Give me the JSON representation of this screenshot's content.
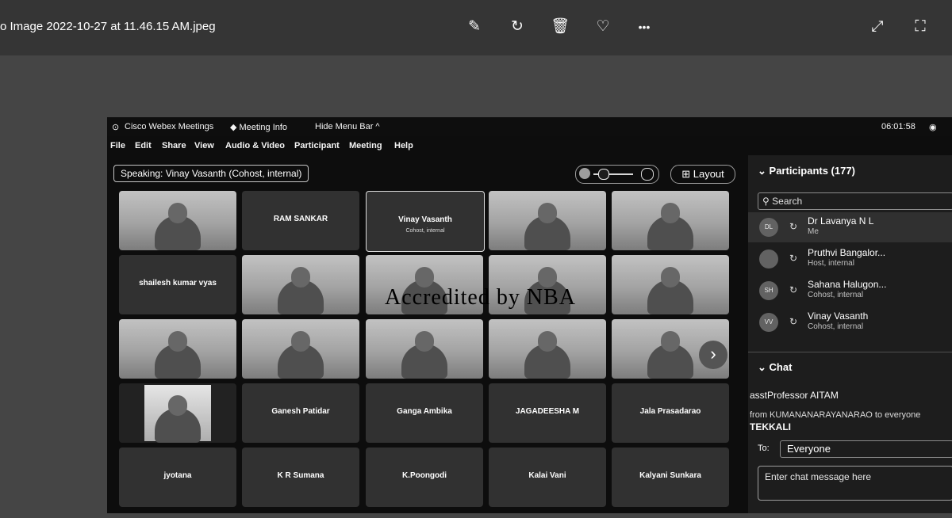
{
  "viewer": {
    "title": "o Image 2022-10-27 at 11.46.15 AM.jpeg",
    "icons": [
      "edit-icon",
      "rotate-icon",
      "delete-icon",
      "favorite-icon",
      "more-icon",
      "expand-icon",
      "fullscreen-icon"
    ],
    "icon_glyphs": [
      "✎",
      "↻",
      "🗑",
      "♡",
      "•••",
      "⤢",
      "⛶"
    ]
  },
  "webex": {
    "app_title": "Cisco Webex Meetings",
    "meeting_info": "Meeting Info",
    "hide_menu": "Hide Menu Bar ^",
    "clock": "06:01:58",
    "menu": [
      "File",
      "Edit",
      "Share",
      "View",
      "Audio & Video",
      "Participant",
      "Meeting",
      "Help"
    ],
    "speaking": "Speaking: Vinay Vasanth (Cohost, internal)",
    "layout_label": "Layout",
    "watermark": "Accredited by NBA"
  },
  "tiles": [
    {
      "name": "",
      "video": true
    },
    {
      "name": "RAM SANKAR",
      "video": false
    },
    {
      "name": "Vinay Vasanth",
      "sub": "Cohost, internal",
      "video": false,
      "active": true
    },
    {
      "name": "",
      "video": true
    },
    {
      "name": "",
      "video": true
    },
    {
      "name": "shailesh kumar vyas",
      "video": false
    },
    {
      "name": "",
      "video": true
    },
    {
      "name": "",
      "video": true
    },
    {
      "name": "",
      "video": true
    },
    {
      "name": "",
      "video": true
    },
    {
      "name": "",
      "video": true
    },
    {
      "name": "",
      "video": true
    },
    {
      "name": "",
      "video": true
    },
    {
      "name": "",
      "video": true
    },
    {
      "name": "",
      "video": true
    },
    {
      "name": "",
      "video": true,
      "small": true
    },
    {
      "name": "Ganesh Patidar",
      "video": false
    },
    {
      "name": "Ganga Ambika",
      "video": false
    },
    {
      "name": "JAGADEESHA M",
      "video": false
    },
    {
      "name": "Jala Prasadarao",
      "video": false
    },
    {
      "name": "jyotana",
      "video": false
    },
    {
      "name": "K R Sumana",
      "video": false
    },
    {
      "name": "K.Poongodi",
      "video": false
    },
    {
      "name": "Kalai Vani",
      "video": false
    },
    {
      "name": "Kalyani Sunkara",
      "video": false
    }
  ],
  "participants": {
    "header": "Participants (177)",
    "search_placeholder": "Search",
    "list": [
      {
        "initials": "DL",
        "name": "Dr Lavanya N L",
        "role": "Me"
      },
      {
        "initials": "",
        "name": "Pruthvi Bangalor...",
        "role": "Host, internal"
      },
      {
        "initials": "SH",
        "name": "Sahana Halugon...",
        "role": "Cohost, internal"
      },
      {
        "initials": "VV",
        "name": "Vinay Vasanth",
        "role": "Cohost, internal"
      }
    ]
  },
  "chat": {
    "header": "Chat",
    "sender": "asstProfessor AITAM",
    "line": "from KUMANANARAYANARAO to everyone",
    "message": "TEKKALI",
    "to_label": "To:",
    "to_value": "Everyone",
    "input_placeholder": "Enter chat message here"
  }
}
